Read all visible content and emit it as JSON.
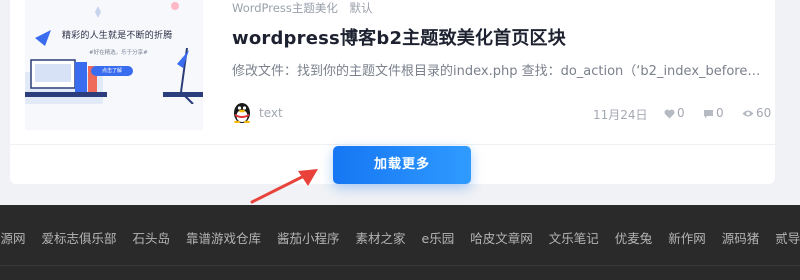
{
  "post": {
    "categories": [
      "WordPress主题美化",
      "默认"
    ],
    "title": "wordpress博客b2主题致美化首页区块",
    "excerpt": "修改文件：找到你的主题文件根目录的index.php 查找：do_action（‘b2_index_before…",
    "thumbnail": {
      "title": "精彩的人生就是不断的折腾",
      "subtitle": "#好在精选，乐于分享#",
      "button": "点击了解"
    },
    "author": {
      "name": "text",
      "avatar_icon": "qq-penguin-icon"
    },
    "stats": {
      "date": "11月24日",
      "likes": "0",
      "comments": "0",
      "views": "60"
    }
  },
  "load_more_label": "加载更多",
  "footer": {
    "links": [
      "资源网",
      "爱标志俱乐部",
      "石头岛",
      "靠谱游戏仓库",
      "酱茄小程序",
      "素材之家",
      "e乐园",
      "哈皮文章网",
      "文乐笔记",
      "优麦兔",
      "新作网",
      "源码猪",
      "贰导航"
    ]
  },
  "colors": {
    "accent": "#1676f3",
    "footer_bg": "#2a2a2a",
    "annotation_arrow": "#e8423a"
  }
}
